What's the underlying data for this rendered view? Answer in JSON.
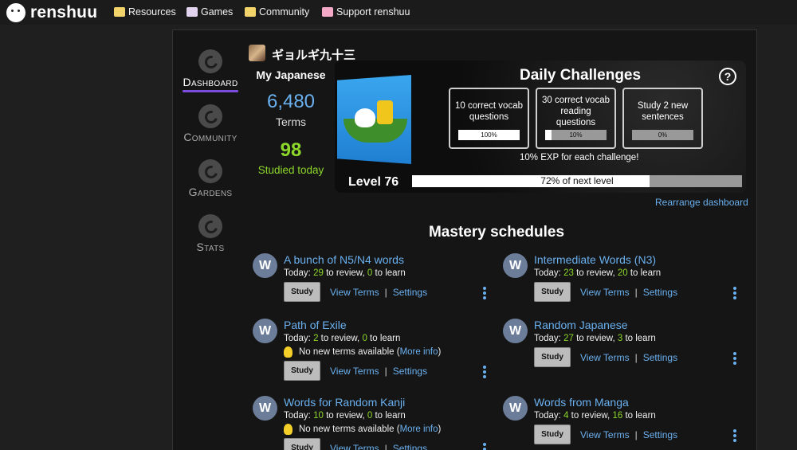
{
  "nav": {
    "logo": "renshuu",
    "items": [
      {
        "label": "Resources",
        "color": "#f3d46b"
      },
      {
        "label": "Games",
        "color": "#e2d4ef"
      },
      {
        "label": "Community",
        "color": "#f3d46b"
      },
      {
        "label": "Support renshuu",
        "color": "#f4a9c6"
      }
    ]
  },
  "sidebar": {
    "items": [
      {
        "label": "Dashboard",
        "active": true
      },
      {
        "label": "Community"
      },
      {
        "label": "Gardens"
      },
      {
        "label": "Stats"
      }
    ]
  },
  "profile": {
    "username": "ギョルギ九十三"
  },
  "my_japanese": {
    "title": "My Japanese",
    "terms_count": "6,480",
    "terms_label": "Terms",
    "studied_count": "98",
    "studied_label": "Studied today"
  },
  "daily": {
    "title": "Daily Challenges",
    "help": "?",
    "challenges": [
      {
        "text": "10 correct vocab questions",
        "progress": 100,
        "pct_label": "100%"
      },
      {
        "text": "30 correct vocab reading questions",
        "progress": 10,
        "pct_label": "10%"
      },
      {
        "text": "Study 2 new sentences",
        "progress": 0,
        "pct_label": "0%"
      }
    ],
    "exp_note": "10% EXP for each challenge!",
    "level_label": "Level 76",
    "level_progress": 72,
    "level_progress_label": "72% of next level"
  },
  "rearrange": "Rearrange dashboard",
  "mastery": {
    "title": "Mastery schedules",
    "avatar_letter": "W",
    "study_label": "Study",
    "view_terms_label": "View Terms",
    "settings_label": "Settings",
    "schedules": [
      {
        "title": "A bunch of N5/N4 words",
        "review": "29",
        "learn": "0",
        "note": null
      },
      {
        "title": "Intermediate Words (N3)",
        "review": "23",
        "learn": "20",
        "note": null
      },
      {
        "title": "Path of Exile",
        "review": "2",
        "learn": "0",
        "note": {
          "text": "No new terms available (",
          "link": "More info",
          "end": ")"
        }
      },
      {
        "title": "Random Japanese",
        "review": "27",
        "learn": "3",
        "note": null
      },
      {
        "title": "Words for Random Kanji",
        "review": "10",
        "learn": "0",
        "note": {
          "text": "No new terms available (",
          "link": "More info",
          "end": ")"
        }
      },
      {
        "title": "Words from Manga",
        "review": "4",
        "learn": "16",
        "note": null
      }
    ],
    "today_prefix": "Today: ",
    "review_suffix": " to review, ",
    "learn_suffix": " to learn"
  }
}
